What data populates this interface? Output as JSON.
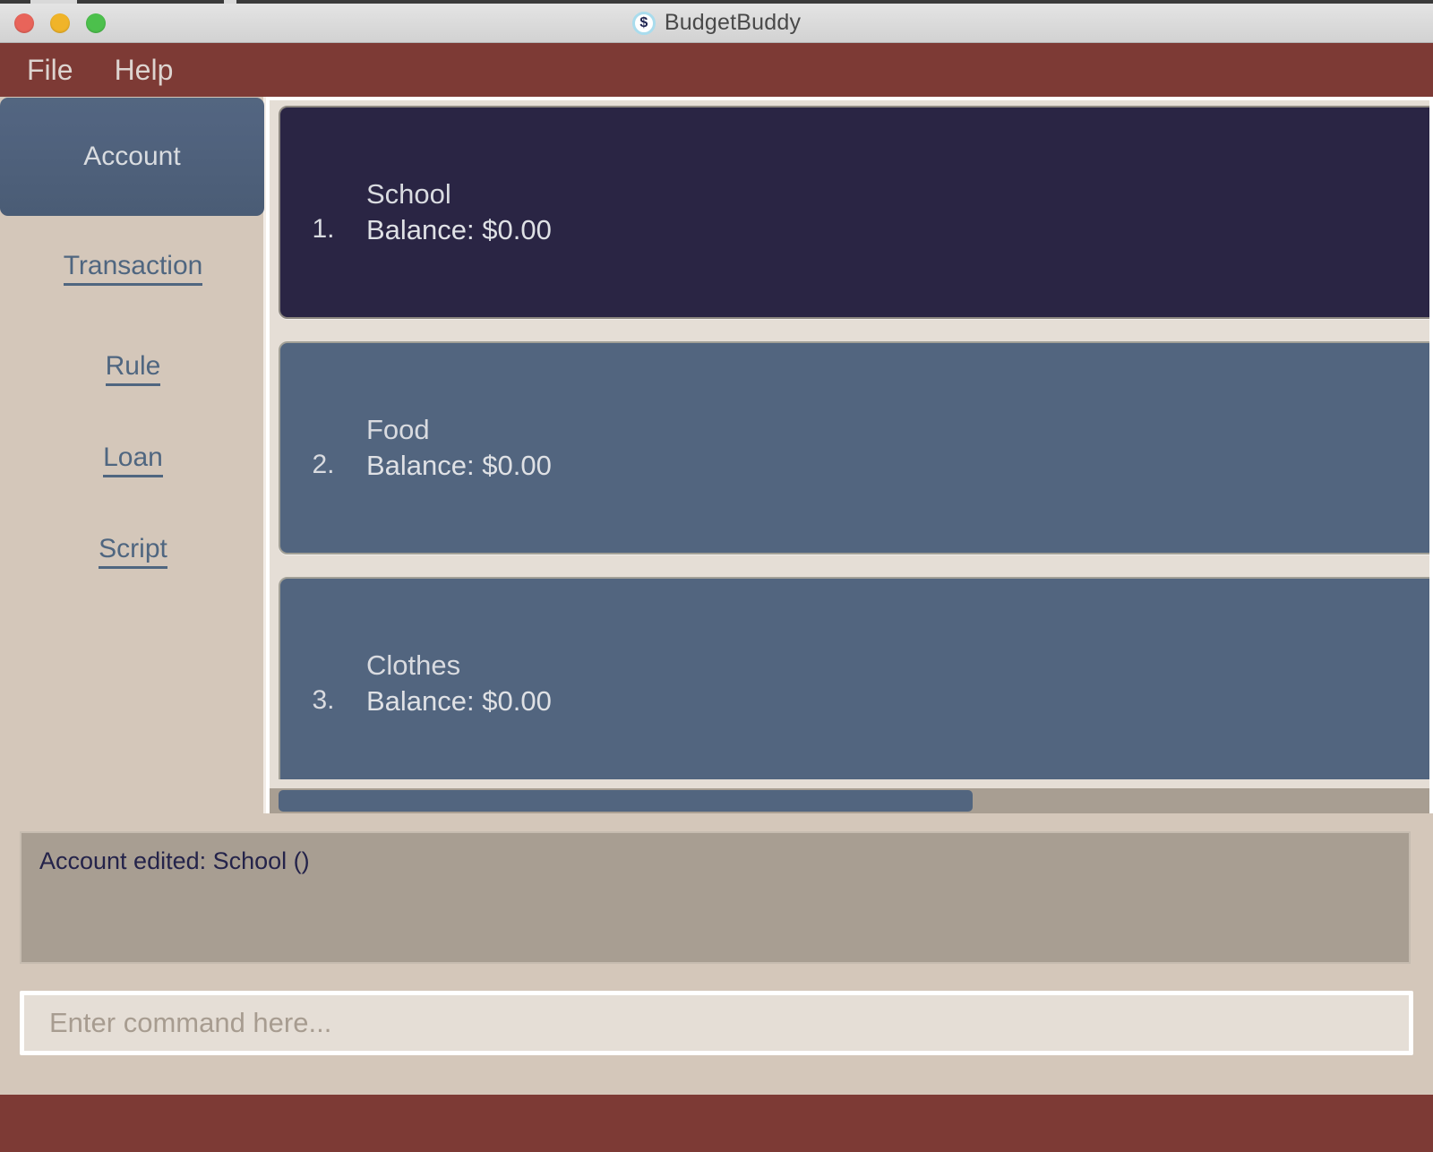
{
  "window": {
    "title": "BudgetBuddy",
    "icon": "dollar-coin-icon",
    "traffic_lights": {
      "close": "close-button",
      "minimize": "minimize-button",
      "zoom": "zoom-button"
    }
  },
  "menubar": {
    "items": [
      {
        "label": "File"
      },
      {
        "label": "Help"
      }
    ]
  },
  "sidebar": {
    "active": {
      "label": "Account"
    },
    "links": [
      {
        "label": "Transaction"
      },
      {
        "label": "Rule"
      },
      {
        "label": "Loan"
      },
      {
        "label": "Script"
      }
    ]
  },
  "accounts": {
    "items": [
      {
        "index": "1.",
        "name": "School",
        "balance": "Balance: $0.00",
        "selected": true
      },
      {
        "index": "2.",
        "name": "Food",
        "balance": "Balance: $0.00",
        "selected": false
      },
      {
        "index": "3.",
        "name": "Clothes",
        "balance": "Balance: $0.00",
        "selected": false
      }
    ]
  },
  "scrollbar": {
    "orientation": "horizontal",
    "thumb_fraction": "0.60"
  },
  "log": {
    "lines": [
      "Account edited: School ()"
    ]
  },
  "command": {
    "value": "",
    "placeholder": "Enter command here..."
  },
  "colors": {
    "menubar": "#7d3a35",
    "sidebar_bg": "#d4c7ba",
    "panel_bg": "#e5ded6",
    "accent_slate": "#52657f",
    "selected_navy": "#2a2544",
    "log_bg": "#a89e92",
    "log_text": "#24234a"
  }
}
